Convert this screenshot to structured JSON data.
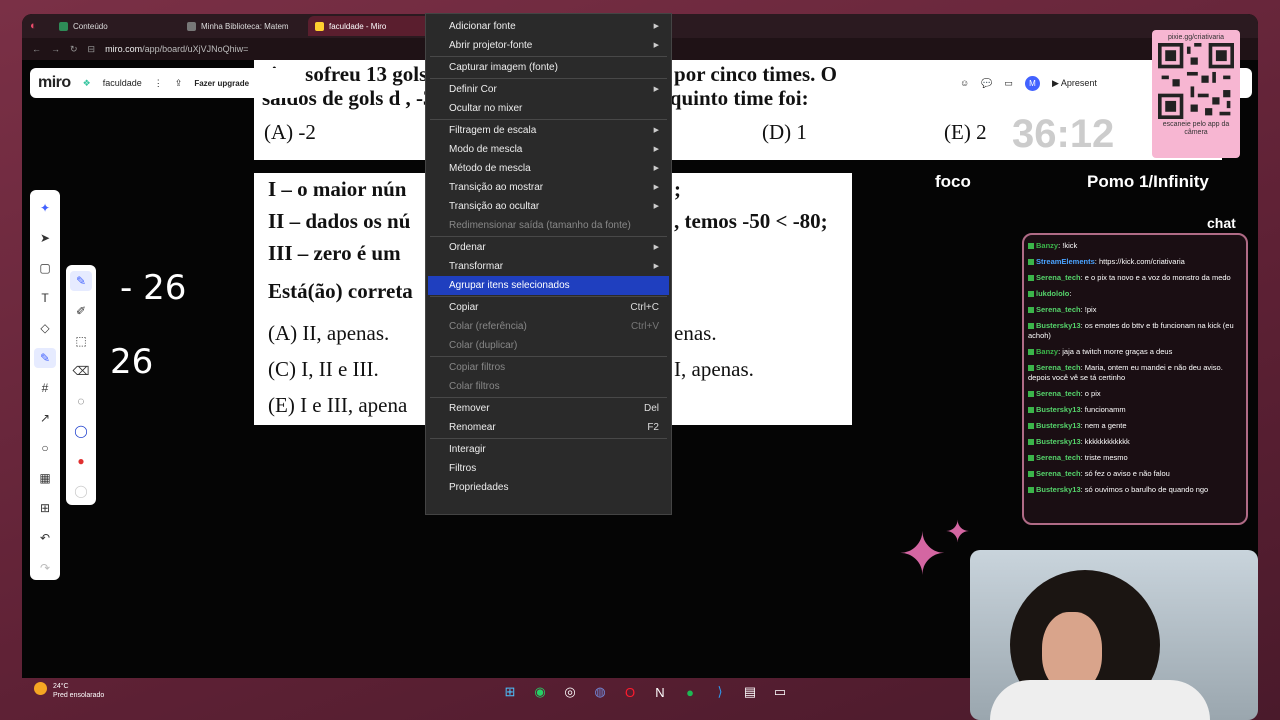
{
  "browser": {
    "tabs": [
      {
        "label": "Conteúdo",
        "color": "#2e8b57",
        "active": false
      },
      {
        "label": "Minha Biblioteca: Matem",
        "color": "#777777",
        "active": false
      },
      {
        "label": "faculdade - Miro",
        "color": "#ffd02f",
        "active": true
      }
    ],
    "url_prefix": "miro.com",
    "url_path": "/app/board/uXjVJNoQhiw="
  },
  "miro": {
    "logo": "miro",
    "board_name": "faculdade",
    "upgrade_label": "Fazer upgrade",
    "avatar": "M",
    "present_label": "Apresent"
  },
  "document1": {
    "line1": "eis e sofreu 13 gols.                                    campeonato foi disputado por cinco times. O",
    "line2": "saldos de gols d                                          , -3, -4 e 3. O saldo de gols do quinto time foi:",
    "opt_a": "(A) -2",
    "opt_d": "(D) 1",
    "opt_e": "(E) 2"
  },
  "timer": "36:12",
  "document2": {
    "l1": "I – o maior nún",
    "l1r": ";",
    "l2": "II – dados os nú",
    "l2r": ", temos -50 < -80;",
    "l3": "III – zero é um",
    "l4": "Está(ão) correta",
    "l5": "(A) II, apenas.",
    "l5r": "enas.",
    "l6": "(C) I, II e III.",
    "l6r": "I, apenas.",
    "l7": "(E) I e III, apena"
  },
  "handwriting": {
    "top": "- 26",
    "bottom": "26"
  },
  "context_menu": {
    "items": [
      {
        "label": "Adicionar fonte",
        "submenu": true
      },
      {
        "label": "Abrir projetor-fonte",
        "submenu": true
      },
      {
        "label": "Capturar imagem (fonte)"
      },
      {
        "label": "Definir Cor",
        "submenu": true
      },
      {
        "label": "Ocultar no mixer"
      },
      {
        "label": "Filtragem de escala",
        "submenu": true
      },
      {
        "label": "Modo de mescla",
        "submenu": true
      },
      {
        "label": "Método de mescla",
        "submenu": true
      },
      {
        "label": "Transição ao mostrar",
        "submenu": true
      },
      {
        "label": "Transição ao ocultar",
        "submenu": true
      },
      {
        "label": "Redimensionar saída (tamanho da fonte)",
        "disabled": true
      },
      {
        "label": "Ordenar",
        "submenu": true
      },
      {
        "label": "Transformar",
        "submenu": true
      },
      {
        "label": "Agrupar itens selecionados",
        "highlighted": true
      },
      {
        "label": "Copiar",
        "shortcut": "Ctrl+C"
      },
      {
        "label": "Colar (referência)",
        "shortcut": "Ctrl+V",
        "disabled": true
      },
      {
        "label": "Colar (duplicar)",
        "disabled": true
      },
      {
        "label": "Copiar filtros",
        "disabled": true
      },
      {
        "label": "Colar filtros",
        "disabled": true
      },
      {
        "label": "Remover",
        "shortcut": "Del"
      },
      {
        "label": "Renomear",
        "shortcut": "F2"
      },
      {
        "label": "Interagir"
      },
      {
        "label": "Filtros"
      },
      {
        "label": "Propriedades"
      }
    ]
  },
  "overlay": {
    "foco": "foco",
    "pomo": "Pomo 1/Infinity",
    "chat_title": "chat",
    "qr_top": "pixie.gg/criativaria",
    "qr_bottom": "escaneie pelo app da câmera"
  },
  "chat": [
    {
      "user": "Banzy",
      "text": "!kick",
      "color": "#3bb54a"
    },
    {
      "user": "StreamElements",
      "text": "https://kick.com/criativaria",
      "color": "#4aa3ff"
    },
    {
      "user": "Serena_tech",
      "text": "e o pix ta novo e a voz do monstro da medo",
      "color": "#55d46b"
    },
    {
      "user": "lukdololo",
      "text": "",
      "color": "#55d46b"
    },
    {
      "user": "Serena_tech",
      "text": "!pix",
      "color": "#55d46b"
    },
    {
      "user": "Bustersky13",
      "text": "os emotes do bttv e tb funcionam na kick (eu achoh)",
      "color": "#55d46b"
    },
    {
      "user": "Banzy",
      "text": "jaja a twitch morre graças a deus",
      "color": "#3bb54a"
    },
    {
      "user": "Serena_tech",
      "text": "Maria, ontem eu mandei e não deu aviso. depois você vê se tá certinho",
      "color": "#55d46b"
    },
    {
      "user": "Serena_tech",
      "text": "o pix",
      "color": "#55d46b"
    },
    {
      "user": "Bustersky13",
      "text": "funcionamm",
      "color": "#55d46b"
    },
    {
      "user": "Bustersky13",
      "text": "nem a gente",
      "color": "#55d46b"
    },
    {
      "user": "Bustersky13",
      "text": "kkkkkkkkkkkk",
      "color": "#55d46b"
    },
    {
      "user": "Serena_tech",
      "text": "triste mesmo",
      "color": "#55d46b"
    },
    {
      "user": "Serena_tech",
      "text": "só fez o aviso e não falou",
      "color": "#55d46b"
    },
    {
      "user": "Bustersky13",
      "text": "só ouvimos o barulho de quando ngo",
      "color": "#55d46b"
    }
  ],
  "taskbar": {
    "temp": "24°C",
    "weather": "Pred ensolarado"
  }
}
